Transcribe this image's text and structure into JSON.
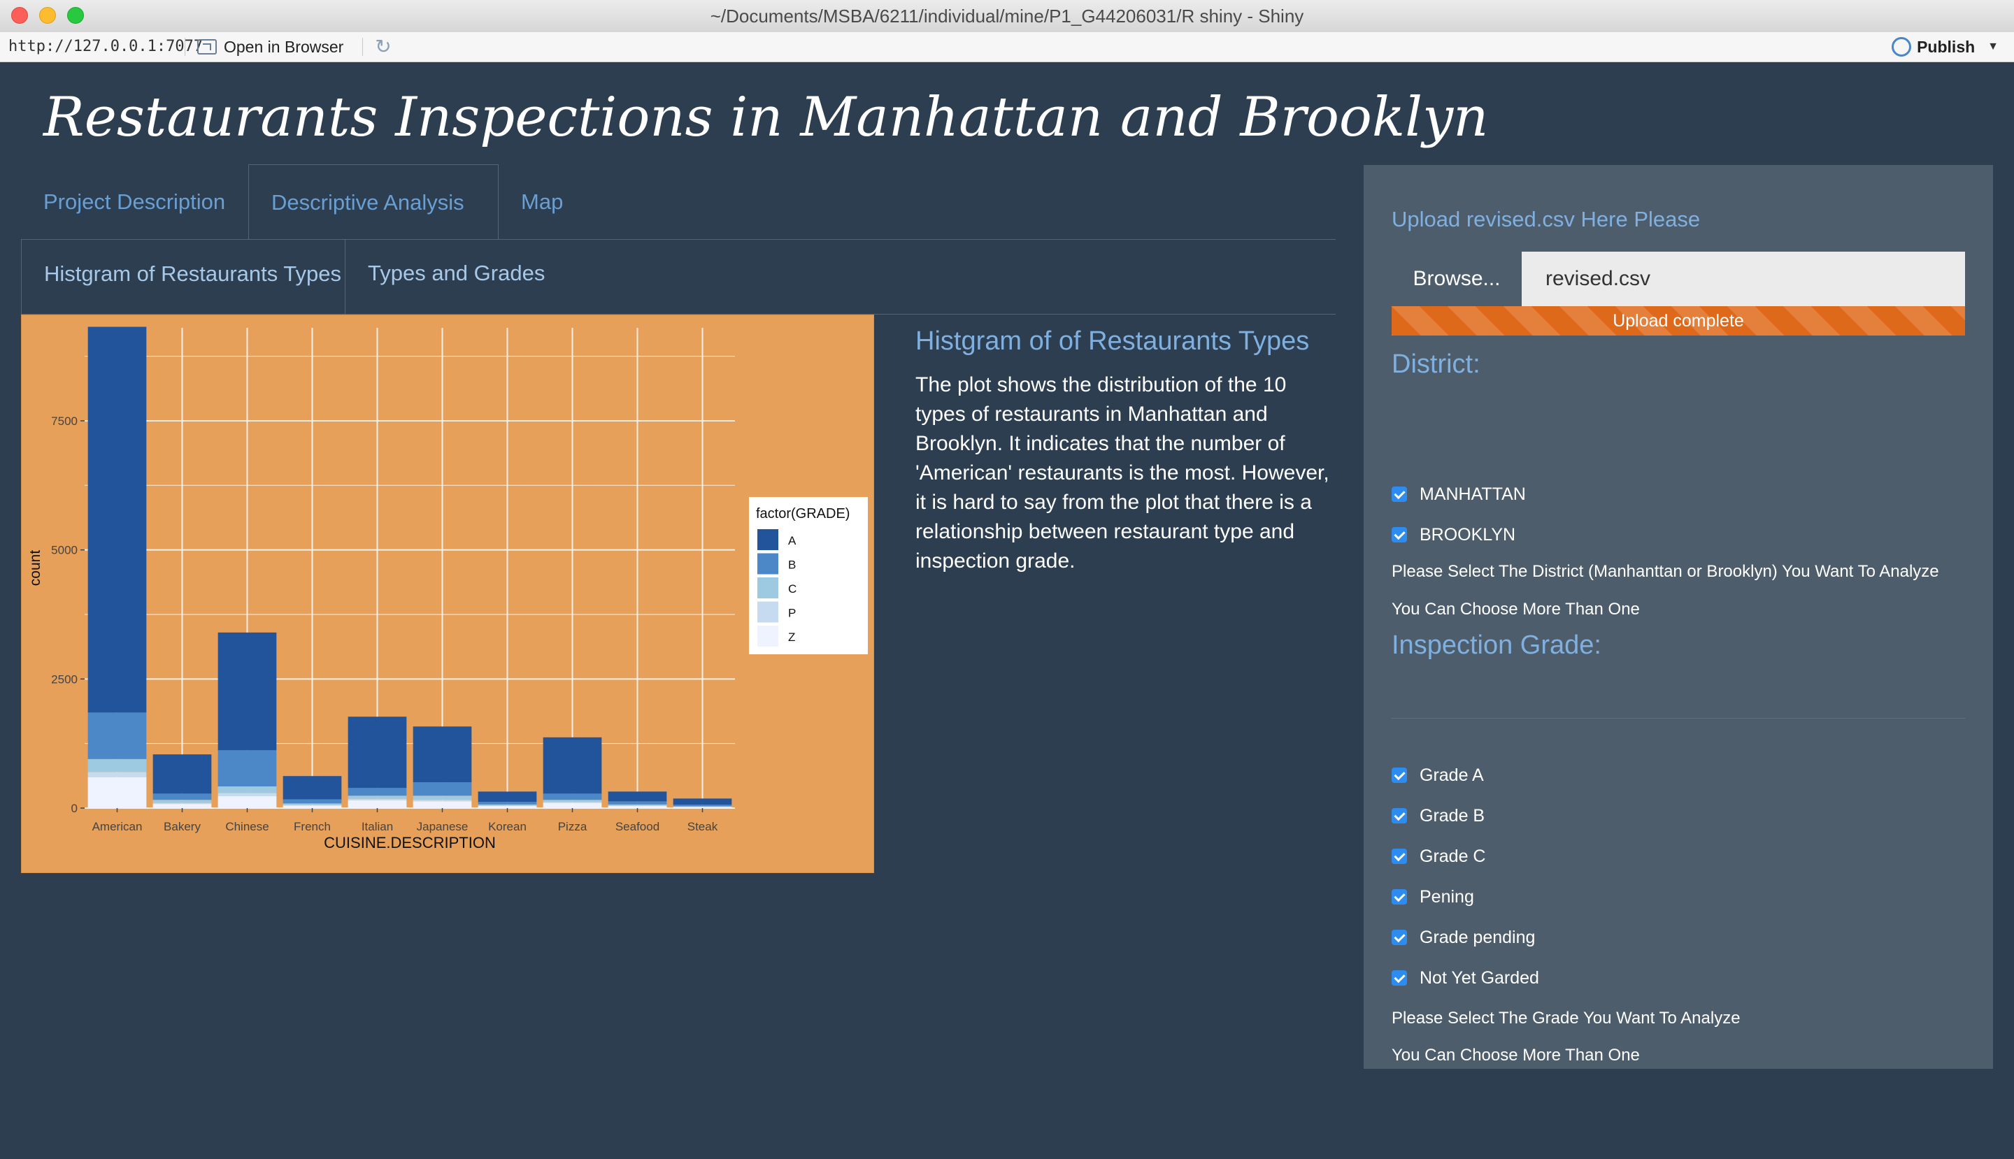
{
  "window": {
    "title": "~/Documents/MSBA/6211/individual/mine/P1_G44206031/R shiny - Shiny"
  },
  "toolbar": {
    "url": "http://127.0.0.1:7077",
    "open_in_browser": "Open in Browser",
    "publish": "Publish"
  },
  "app": {
    "title": "Restaurants Inspections in Manhattan and Brooklyn",
    "tabs": [
      {
        "label": "Project Description",
        "active": false
      },
      {
        "label": "Descriptive Analysis",
        "active": true
      },
      {
        "label": "Map",
        "active": false
      }
    ],
    "subtabs": [
      {
        "label": "Histgram of Restaurants Types",
        "active": true
      },
      {
        "label": "Types and Grades",
        "active": false
      }
    ],
    "description": {
      "title": "Histgram of of Restaurants Types",
      "text": "The plot shows the distribution of the 10 types of restaurants in Manhattan and Brooklyn. It indicates that the number of 'American' restaurants is the most. However, it is hard to say from the plot that there is a relationship between restaurant type and inspection grade."
    }
  },
  "sidebar": {
    "upload_label": "Upload revised.csv Here Please",
    "browse_label": "Browse...",
    "file_name": "revised.csv",
    "progress_text": "Upload complete",
    "progress_fraction": 1.0,
    "district": {
      "title": "District:",
      "options": [
        {
          "label": "MANHATTAN",
          "checked": true
        },
        {
          "label": "BROOKLYN",
          "checked": true
        }
      ],
      "help1": "Please Select The District (Manhanttan or Brooklyn) You Want To Analyze",
      "help2": "You Can Choose More Than One"
    },
    "grade": {
      "title": "Inspection Grade:",
      "options": [
        {
          "label": "Grade A",
          "checked": true
        },
        {
          "label": "Grade B",
          "checked": true
        },
        {
          "label": "Grade C",
          "checked": true
        },
        {
          "label": "Pening",
          "checked": true
        },
        {
          "label": "Grade pending",
          "checked": true
        },
        {
          "label": "Not Yet Garded",
          "checked": true
        }
      ],
      "help1": "Please Select The Grade You Want To Analyze",
      "help2": "You Can Choose More Than One"
    }
  },
  "colors": {
    "background": "#2c3e50",
    "sidebar": "#4e5d6c",
    "plot_background": "#e6a05a",
    "accent": "#df691a",
    "link": "#6a9fd4"
  },
  "chart_data": {
    "type": "bar",
    "stacked": true,
    "xlabel": "CUISINE.DESCRIPTION",
    "ylabel": "count",
    "ylim": [
      0,
      9300
    ],
    "yticks": [
      0,
      2500,
      5000,
      7500
    ],
    "ytick_labels": [
      "0",
      "2500",
      "5000",
      "7500"
    ],
    "legend_title": "factor(GRADE)",
    "legend_position": "right",
    "categories": [
      "American",
      "Bakery",
      "Chinese",
      "French",
      "Italian",
      "Japanese",
      "Korean",
      "Pizza",
      "Seafood",
      "Steak"
    ],
    "series": [
      {
        "name": "Z",
        "color": "#eff3ff",
        "values": [
          600,
          80,
          230,
          50,
          150,
          130,
          40,
          100,
          40,
          20
        ]
      },
      {
        "name": "P",
        "color": "#c6dbef",
        "values": [
          100,
          20,
          60,
          10,
          30,
          30,
          10,
          20,
          10,
          5
        ]
      },
      {
        "name": "C",
        "color": "#9ecae1",
        "values": [
          250,
          60,
          130,
          30,
          60,
          80,
          20,
          40,
          20,
          10
        ]
      },
      {
        "name": "B",
        "color": "#4c88c8",
        "values": [
          900,
          120,
          700,
          80,
          150,
          260,
          50,
          120,
          60,
          30
        ]
      },
      {
        "name": "A",
        "color": "#22549c",
        "values": [
          7470,
          760,
          2280,
          450,
          1380,
          1080,
          200,
          1090,
          190,
          120
        ]
      }
    ]
  }
}
